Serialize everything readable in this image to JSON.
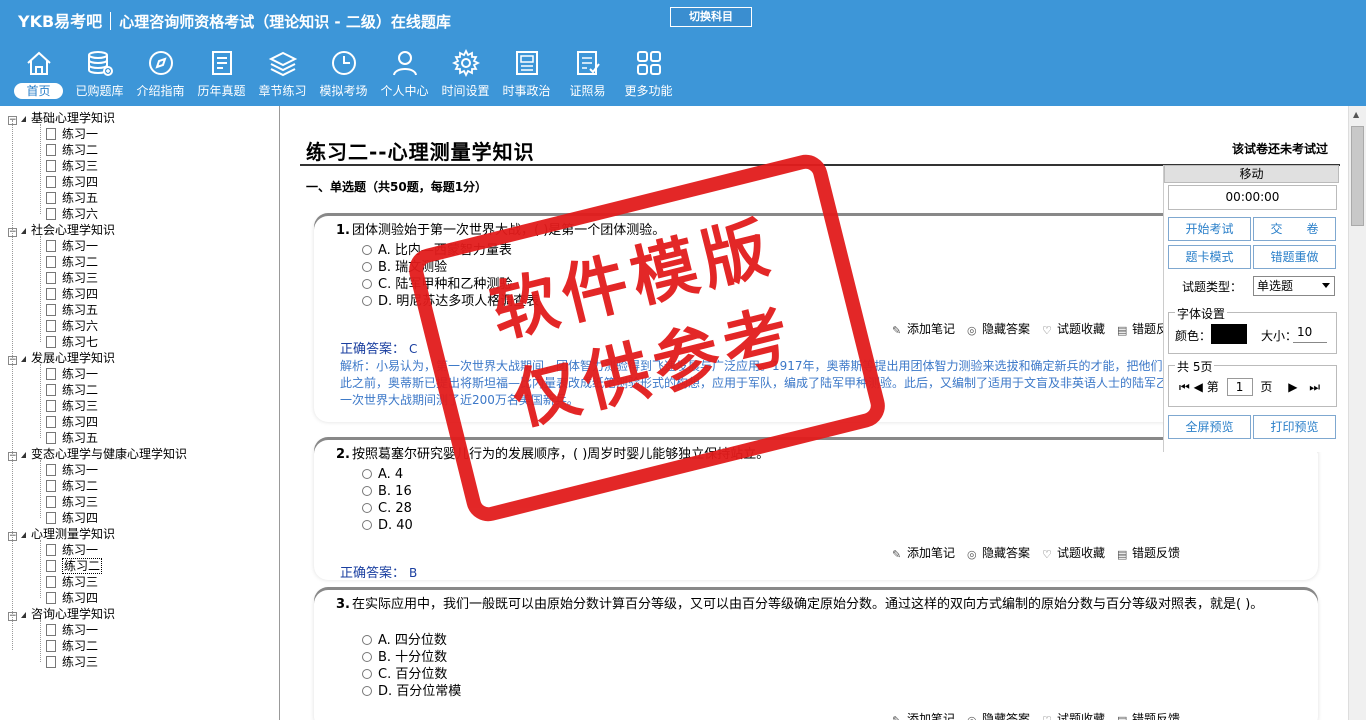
{
  "header": {
    "logo": "YKB易考吧",
    "subject_title": "心理咨询师资格考试（理论知识 - 二级）在线题库",
    "switch_label": "切换科目"
  },
  "nav": [
    {
      "label": "首页",
      "icon": "home-icon"
    },
    {
      "label": "已购题库",
      "icon": "database-icon"
    },
    {
      "label": "介绍指南",
      "icon": "compass-icon"
    },
    {
      "label": "历年真题",
      "icon": "list-icon"
    },
    {
      "label": "章节练习",
      "icon": "layers-icon"
    },
    {
      "label": "模拟考场",
      "icon": "clock-icon"
    },
    {
      "label": "个人中心",
      "icon": "user-icon"
    },
    {
      "label": "时间设置",
      "icon": "gear-icon"
    },
    {
      "label": "时事政治",
      "icon": "newspaper-icon"
    },
    {
      "label": "证照易",
      "icon": "checklist-icon"
    },
    {
      "label": "更多功能",
      "icon": "grid-icon"
    }
  ],
  "tree": [
    {
      "label": "基础心理学知识",
      "children": [
        "练习一",
        "练习二",
        "练习三",
        "练习四",
        "练习五",
        "练习六"
      ]
    },
    {
      "label": "社会心理学知识",
      "children": [
        "练习一",
        "练习二",
        "练习三",
        "练习四",
        "练习五",
        "练习六",
        "练习七"
      ]
    },
    {
      "label": "发展心理学知识",
      "children": [
        "练习一",
        "练习二",
        "练习三",
        "练习四",
        "练习五"
      ]
    },
    {
      "label": "变态心理学与健康心理学知识",
      "children": [
        "练习一",
        "练习二",
        "练习三",
        "练习四"
      ]
    },
    {
      "label": "心理测量学知识",
      "children": [
        "练习一",
        "练习二",
        "练习三",
        "练习四"
      ]
    },
    {
      "label": "咨询心理学知识",
      "children": [
        "练习一",
        "练习二",
        "练习三"
      ]
    }
  ],
  "main": {
    "paper_title": "练习二--心理测量学知识",
    "exam_status": "该试卷还未考试过",
    "section_title": "一、单选题（共50题，每题1分）",
    "answer_label": "正确答案：",
    "actions": [
      "添加笔记",
      "隐藏答案",
      "试题收藏",
      "错题反馈"
    ],
    "questions": [
      {
        "num": "1.",
        "text": "团体测验始于第一次世界大战，( )是第一个团体测验。",
        "options": [
          "A. 比内—西蒙智力量表",
          "B. 瑞文测验",
          "C. 陆军甲种和乙种测验",
          "D. 明尼苏达多项人格调查表"
        ],
        "answer": "C",
        "explanation": "解析：小易认为，第一次世界大战期间，团体智力测验得到飞速发展与广泛应用。1917年，奥蒂斯等提出用团体智力测验来选拔和确定新兵的才能，把他们分配到适当的岗位上。在此之前，奥蒂斯已提出将斯坦福—比内量表改成纸笔测验形式的构想，应用于军队，编成了陆军甲种测验。此后，又编制了适用于文盲及非英语人士的陆军乙种测验。这两个测验在第一次世界大战期间测了近200万名美国新兵。"
      },
      {
        "num": "2.",
        "text": "按照葛塞尔研究婴儿行为的发展顺序，( )周岁时婴儿能够独立保持站立。",
        "options": [
          "A. 4",
          "B. 16",
          "C. 28",
          "D. 40"
        ],
        "answer": "B"
      },
      {
        "num": "3.",
        "text": "在实际应用中，我们一般既可以由原始分数计算百分等级，又可以由百分等级确定原始分数。通过这样的双向方式编制的原始分数与百分等级对照表，就是( )。",
        "options": [
          "A. 四分位数",
          "B. 十分位数",
          "C. 百分位数",
          "D. 百分位常模"
        ]
      }
    ]
  },
  "panel": {
    "move": "移动",
    "timer": "00:00:00",
    "start_exam": "开始考试",
    "submit": "交　　卷",
    "card_mode": "题卡模式",
    "redo_wrong": "错题重做",
    "qtype_label": "试题类型：",
    "qtype_value": "单选题",
    "font_legend": "字体设置",
    "color_label": "颜色：",
    "size_label": "大小：",
    "size_value": "10",
    "pages_legend": "共 5页",
    "page_prefix": "第",
    "page_value": "1",
    "page_suffix": "页",
    "fullscreen": "全屏预览",
    "print": "打印预览"
  },
  "watermark": {
    "line1": "软件模版",
    "line2": "仅供参考"
  },
  "colors": {
    "topbar": "#3d96d8",
    "stamp": "#e21c1c",
    "answer": "#1a3fa0",
    "explanation": "#3c78c8"
  }
}
